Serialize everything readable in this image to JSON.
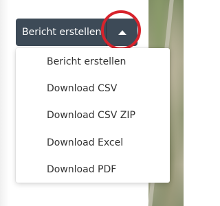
{
  "split_button": {
    "label": "Bericht erstellen",
    "toggle_icon": "caret-up-icon"
  },
  "dropdown": {
    "items": [
      {
        "label": "Bericht erstellen"
      },
      {
        "label": "Download CSV"
      },
      {
        "label": "Download CSV ZIP"
      },
      {
        "label": "Download Excel"
      },
      {
        "label": "Download PDF"
      }
    ]
  },
  "colors": {
    "button_bg": "#3d4a57",
    "button_text": "#ffffff",
    "highlight": "#d7232c",
    "menu_text": "#333333",
    "menu_bg": "#ffffff"
  }
}
